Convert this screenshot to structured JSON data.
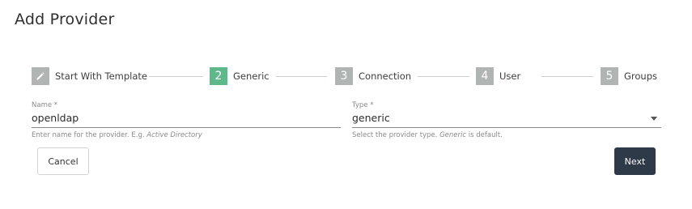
{
  "page": {
    "title": "Add Provider"
  },
  "stepper": {
    "steps": [
      {
        "marker": "",
        "label": "Start With Template",
        "icon": "pencil-icon",
        "state": "done"
      },
      {
        "marker": "2",
        "label": "Generic",
        "state": "active"
      },
      {
        "marker": "3",
        "label": "Connection",
        "state": "pending"
      },
      {
        "marker": "4",
        "label": "User",
        "state": "pending"
      },
      {
        "marker": "5",
        "label": "Groups",
        "state": "pending"
      }
    ],
    "colors": {
      "active": "#5fb88a",
      "inactive": "#b0b4b2"
    }
  },
  "form": {
    "name": {
      "label": "Name *",
      "value": "openldap",
      "hint_prefix": "Enter name for the provider. E.g. ",
      "hint_example": "Active Directory"
    },
    "type": {
      "label": "Type *",
      "value": "generic",
      "hint_prefix": "Select the provider type. ",
      "hint_example": "Generic",
      "hint_suffix": " is default."
    }
  },
  "actions": {
    "cancel_label": "Cancel",
    "next_label": "Next",
    "next_color": "#2e3a48"
  }
}
